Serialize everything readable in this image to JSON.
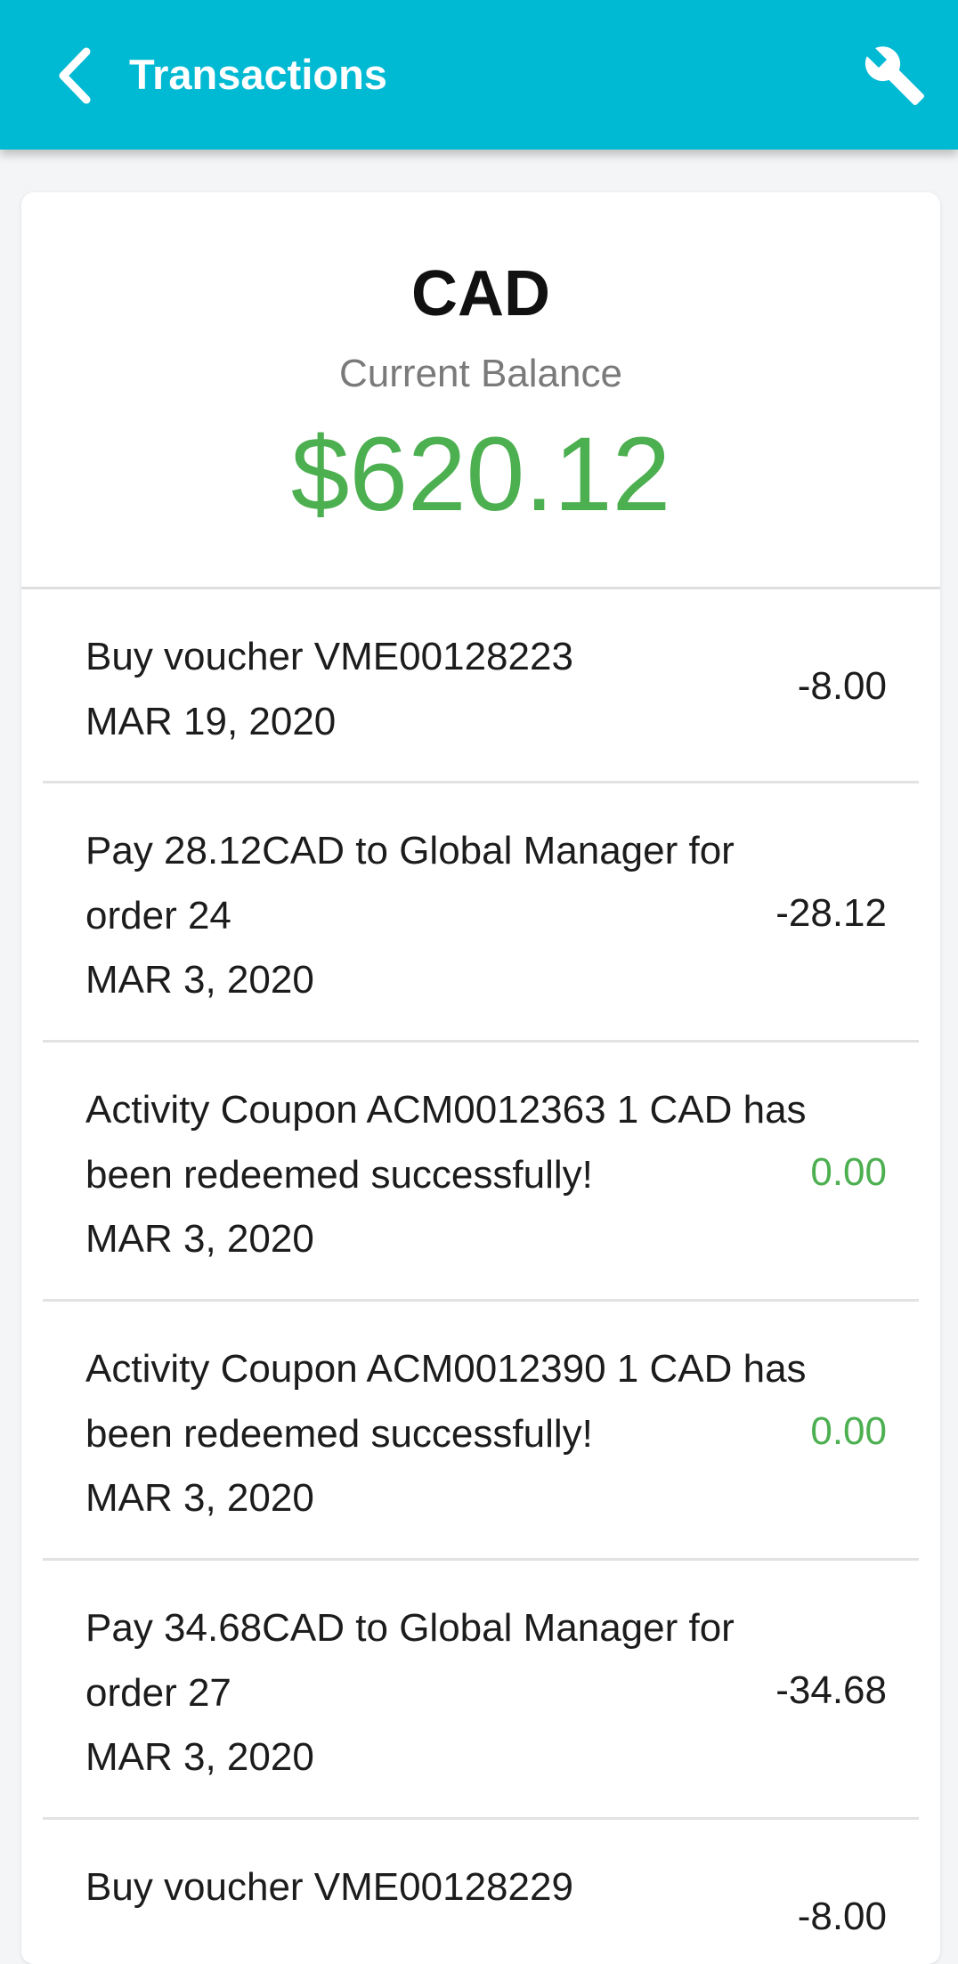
{
  "header": {
    "title": "Transactions",
    "back_icon": "chevron-left-icon",
    "settings_icon": "wrench-icon",
    "background_color": "#00b9d3"
  },
  "balance": {
    "currency": "CAD",
    "label": "Current Balance",
    "amount": "$620.12",
    "amount_color": "#4caf50"
  },
  "transactions": [
    {
      "desc": "Buy voucher VME00128223",
      "date": "MAR 19, 2020",
      "amount": "-8.00",
      "positive": false
    },
    {
      "desc": "Pay 28.12CAD to Global Manager for order 24",
      "date": "MAR 3, 2020",
      "amount": "-28.12",
      "positive": false
    },
    {
      "desc": "Activity Coupon ACM0012363 1 CAD has been redeemed successfully!",
      "date": "MAR 3, 2020",
      "amount": "0.00",
      "positive": true
    },
    {
      "desc": "Activity Coupon ACM0012390 1 CAD has been redeemed successfully!",
      "date": "MAR 3, 2020",
      "amount": "0.00",
      "positive": true
    },
    {
      "desc": "Pay 34.68CAD to Global Manager for order 27",
      "date": "MAR 3, 2020",
      "amount": "-34.68",
      "positive": false
    },
    {
      "desc": "Buy voucher VME00128229",
      "date": "",
      "amount": "-8.00",
      "positive": false
    }
  ]
}
